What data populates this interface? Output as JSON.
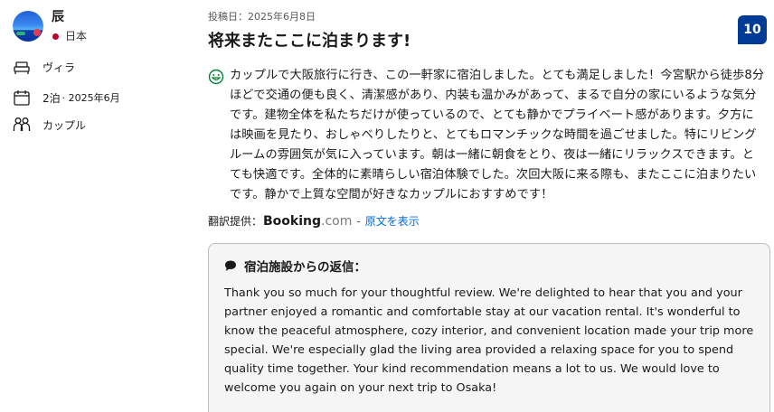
{
  "reviewer": {
    "name": "辰",
    "country": "日本",
    "country_color": "#bc002d"
  },
  "stay": {
    "room_type": "ヴィラ",
    "nights": "2泊",
    "date": "· 2025年6月",
    "traveler_type": "カップル"
  },
  "review": {
    "posted_date": "投稿日：2025年6月8日",
    "title": "将来またここに泊まります!",
    "score": "10",
    "score_color": "#003b95",
    "body": "カップルで大阪旅行に行き、この一軒家に宿泊しました。とても満足しました！今宮駅から徒歩8分ほどで交通の便も良く、清潔感があり、内装も温かみがあって、まるで自分の家にいるような気分です。建物全体を私たちだけが使っているので、とても静かでプライベート感があります。夕方には映画を見たり、おしゃべりしたりと、とてもロマンチックな時間を過ごせました。特にリビングルームの雰囲気が気に入っています。朝は一緒に朝食をとり、夜は一緒にリラックスできます。とても快適です。全体的に素晴らしい宿泊体験でした。次回大阪に来る際も、またここに泊まりたいです。静かで上質な空間が好きなカップルにおすすめです！"
  },
  "translation": {
    "label": "翻訳提供：",
    "brand_main": "Booking",
    "brand_suffix": ".com",
    "separator": "-",
    "show_original": "原文を表示",
    "link_color": "#006ce4"
  },
  "reply": {
    "heading": "宿泊施設からの返信：",
    "body": "Thank you so much for your thoughtful review. We're delighted to hear that you and your partner enjoyed a romantic and comfortable stay at our vacation rental. It's wonderful to know the peaceful atmosphere, cozy interior, and convenient location made your trip more special. We're especially glad the living area provided a relaxing space for you to spend quality time together. Your kind recommendation means a lot to us. We would love to welcome you again on your next trip to Osaka!"
  },
  "icons": {
    "bed": "bed-icon",
    "calendar": "calendar-icon",
    "people": "people-icon",
    "smile": "smile-icon",
    "speech": "speech-bubble-icon"
  }
}
